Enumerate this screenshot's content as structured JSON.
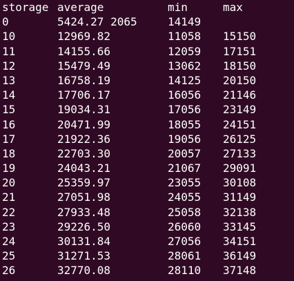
{
  "terminal": {
    "background": "#300a24",
    "foreground": "#ffffff",
    "header": {
      "storage": "storage",
      "average": "average",
      "min": "min",
      "max": "max"
    },
    "rows": [
      {
        "storage": "0",
        "average": "5424.27 2065",
        "min": "14149",
        "max": ""
      },
      {
        "storage": "10",
        "average": "12969.82",
        "min": "11058",
        "max": "15150"
      },
      {
        "storage": "11",
        "average": "14155.66",
        "min": "12059",
        "max": "17151"
      },
      {
        "storage": "12",
        "average": "15479.49",
        "min": "13062",
        "max": "18150"
      },
      {
        "storage": "13",
        "average": "16758.19",
        "min": "14125",
        "max": "20150"
      },
      {
        "storage": "14",
        "average": "17706.17",
        "min": "16056",
        "max": "21146"
      },
      {
        "storage": "15",
        "average": "19034.31",
        "min": "17056",
        "max": "23149"
      },
      {
        "storage": "16",
        "average": "20471.99",
        "min": "18055",
        "max": "24151"
      },
      {
        "storage": "17",
        "average": "21922.36",
        "min": "19056",
        "max": "26125"
      },
      {
        "storage": "18",
        "average": "22703.30",
        "min": "20057",
        "max": "27133"
      },
      {
        "storage": "19",
        "average": "24043.21",
        "min": "21067",
        "max": "29091"
      },
      {
        "storage": "20",
        "average": "25359.97",
        "min": "23055",
        "max": "30108"
      },
      {
        "storage": "21",
        "average": "27051.98",
        "min": "24055",
        "max": "31149"
      },
      {
        "storage": "22",
        "average": "27933.48",
        "min": "25058",
        "max": "32138"
      },
      {
        "storage": "23",
        "average": "29226.50",
        "min": "26060",
        "max": "33145"
      },
      {
        "storage": "24",
        "average": "30131.84",
        "min": "27056",
        "max": "34151"
      },
      {
        "storage": "25",
        "average": "31271.53",
        "min": "28061",
        "max": "36149"
      },
      {
        "storage": "26",
        "average": "32770.08",
        "min": "28110",
        "max": "37148"
      }
    ]
  }
}
